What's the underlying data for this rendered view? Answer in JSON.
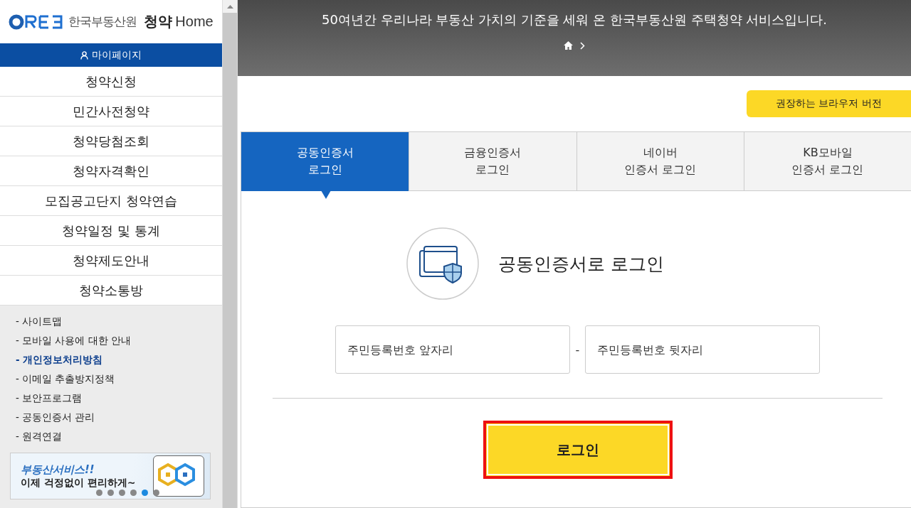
{
  "logo": {
    "org": "한국부동산원",
    "product": "청약",
    "product_suffix": "Home"
  },
  "mypage": {
    "label": "마이페이지"
  },
  "menu": [
    {
      "label": "청약신청"
    },
    {
      "label": "민간사전청약"
    },
    {
      "label": "청약당첨조회"
    },
    {
      "label": "청약자격확인"
    },
    {
      "label": "모집공고단지 청약연습"
    },
    {
      "label": "청약일정 및 통계"
    },
    {
      "label": "청약제도안내"
    },
    {
      "label": "청약소통방"
    }
  ],
  "footer_links": [
    {
      "label": "- 사이트맵",
      "emphasized": false
    },
    {
      "label": "- 모바일 사용에 대한 안내",
      "emphasized": false
    },
    {
      "label": "- 개인정보처리방침",
      "emphasized": true
    },
    {
      "label": "- 이메일 추출방지정책",
      "emphasized": false
    },
    {
      "label": "- 보안프로그램",
      "emphasized": false
    },
    {
      "label": "- 공동인증서 관리",
      "emphasized": false
    },
    {
      "label": "- 원격연결",
      "emphasized": false
    }
  ],
  "banner": {
    "title": "부동산서비스!!",
    "subtitle": "이제 걱정없이 편리하게~",
    "dots": [
      {
        "selected": false
      },
      {
        "selected": false
      },
      {
        "selected": false
      },
      {
        "selected": false
      },
      {
        "selected": true
      },
      {
        "selected": false
      }
    ]
  },
  "header": {
    "message": "50여년간 우리나라 부동산 가치의 기준을 세워 온 한국부동산원 주택청약 서비스입니다."
  },
  "browser_button": {
    "label": "권장하는 브라우저 버전"
  },
  "tabs": [
    {
      "lines": [
        "공동인증서",
        "로그인"
      ],
      "selected": true
    },
    {
      "lines": [
        "금융인증서",
        "로그인"
      ],
      "selected": false
    },
    {
      "lines": [
        "네이버",
        "인증서 로그인"
      ],
      "selected": false
    },
    {
      "lines": [
        "KB모바일",
        "인증서 로그인"
      ],
      "selected": false
    }
  ],
  "login": {
    "title": "공동인증서로 로그인",
    "fields": [
      {
        "placeholder": "주민등록번호 앞자리"
      },
      {
        "placeholder": "주민등록번호 뒷자리"
      }
    ],
    "separator": "-",
    "button": "로그인"
  }
}
